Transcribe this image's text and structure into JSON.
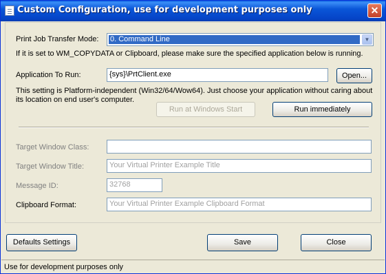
{
  "window": {
    "title": "Custom Configuration, use for development purposes only",
    "close_glyph": "✕"
  },
  "transfer_mode": {
    "label": "Print Job Transfer Mode:",
    "selected": "0. Command Line",
    "note": "If it is set to WM_COPYDATA or Clipboard, please make sure the specified application below is running."
  },
  "application": {
    "label": "Application To Run:",
    "value": "{sys}\\PrtClient.exe",
    "open_label": "Open...",
    "note_line1": "This setting is Platform-independent (Win32/64/Wow64). Just choose your application without caring about",
    "note_line2": "its location on end user's computer.",
    "run_at_start_label": "Run at Windows Start",
    "run_now_label": "Run immediately"
  },
  "target": {
    "class_label": "Target Window Class:",
    "class_value": "",
    "title_label": "Target Window Title:",
    "title_placeholder": "Your Virtual Printer Example Title",
    "message_label": "Message ID:",
    "message_placeholder": "32768",
    "clipboard_label": "Clipboard Format:",
    "clipboard_placeholder": "Your Virtual Printer Example Clipboard Format"
  },
  "buttons": {
    "defaults": "Defaults Settings",
    "save": "Save",
    "close": "Close"
  },
  "status": {
    "text": "Use for development purposes only"
  },
  "icons": {
    "window_icon": "document-icon",
    "dropdown": "chevron-down-icon"
  }
}
